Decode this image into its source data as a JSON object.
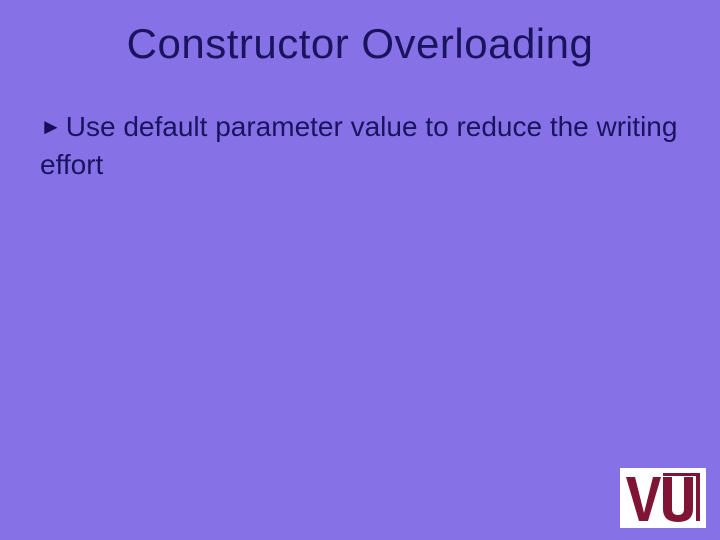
{
  "slide": {
    "title": "Constructor Overloading",
    "bullet_text": "Use default parameter value to reduce the writing effort"
  },
  "logo": {
    "text": "VU"
  },
  "colors": {
    "background": "#8672e6",
    "text": "#1a1460",
    "logo_fg": "#801434",
    "logo_bg": "#ffffff"
  }
}
